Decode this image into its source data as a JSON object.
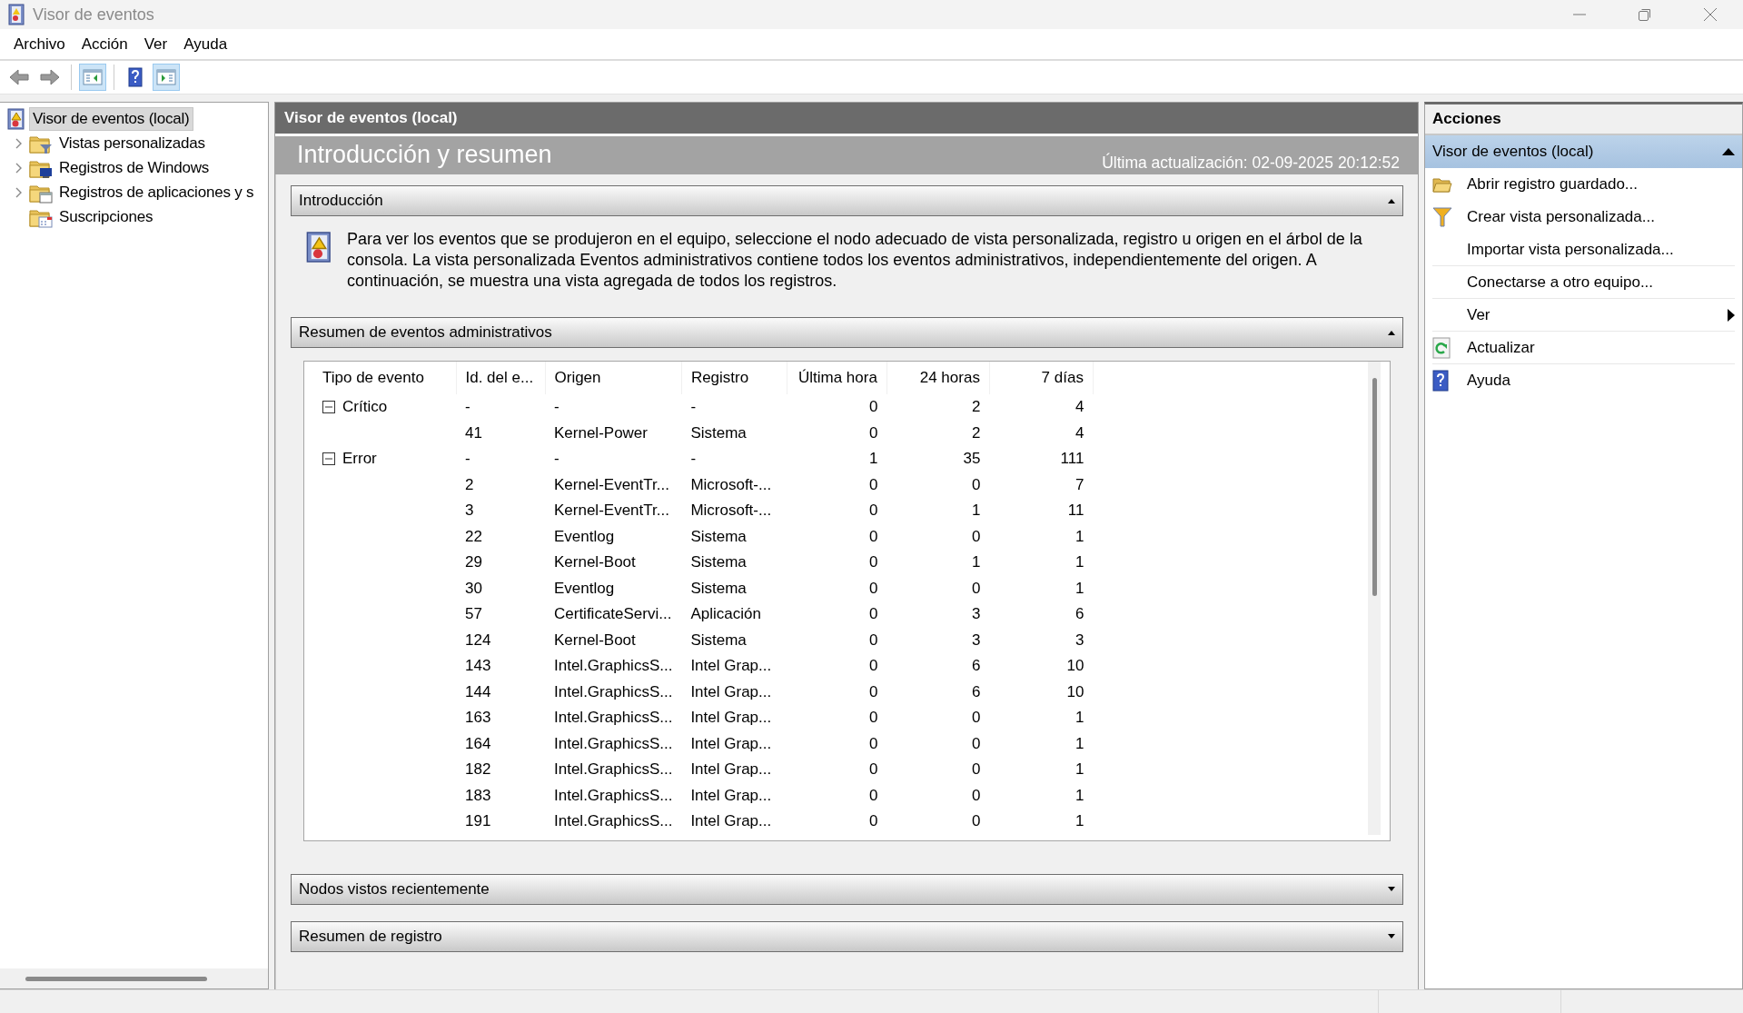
{
  "window": {
    "title": "Visor de eventos"
  },
  "menu": [
    {
      "label": "Archivo"
    },
    {
      "label": "Acción"
    },
    {
      "label": "Ver"
    },
    {
      "label": "Ayuda"
    }
  ],
  "toolbar_groups": [
    {
      "buttons": [
        {
          "kind": "back",
          "on": false,
          "disabled": true
        },
        {
          "kind": "forward",
          "on": false,
          "disabled": true
        }
      ]
    },
    {
      "buttons": [
        {
          "kind": "tree-pane",
          "on": true,
          "disabled": false
        }
      ]
    },
    {
      "buttons": [
        {
          "kind": "help",
          "on": false,
          "disabled": false
        },
        {
          "kind": "action-pane",
          "on": true,
          "disabled": false
        }
      ]
    }
  ],
  "tree": [
    {
      "label": "Visor de eventos (local)",
      "kind": "log",
      "selected": true,
      "children": [
        {
          "label": "Vistas personalizadas",
          "kind": "filter-folder",
          "selected": false,
          "expandable": true
        },
        {
          "label": "Registros de Windows",
          "kind": "windows-folder",
          "selected": false,
          "expandable": true
        },
        {
          "label": "Registros de aplicaciones y s",
          "kind": "window-folder",
          "selected": false,
          "expandable": true
        },
        {
          "label": "Suscripciones",
          "kind": "calendar-folder",
          "selected": false,
          "expandable": false
        }
      ]
    }
  ],
  "center": {
    "title": "Visor de eventos (local)",
    "heading": "Introducción y resumen",
    "updated": "Última actualización: 02-09-2025 20:12:52",
    "sections": [
      {
        "title": "Introducción",
        "expanded": true,
        "kind": "text",
        "text": "Para ver los eventos que se produjeron en el equipo, seleccione el nodo adecuado de vista personalizada, registro u origen en el árbol de la consola. La vista personalizada Eventos administrativos contiene todos los eventos administrativos, independientemente del origen. A continuación, se muestra una vista agregada de todos los registros."
      },
      {
        "title": "Resumen de eventos administrativos",
        "expanded": true,
        "kind": "table",
        "columns": [
          "Tipo de evento",
          "Id. del e...",
          "Origen",
          "Registro",
          "Última hora",
          "24 horas",
          "7 días"
        ],
        "rows": [
          {
            "kind": "group",
            "expanded": true,
            "cells": [
              "Crítico",
              "-",
              "-",
              "-",
              "0",
              "2",
              "4"
            ]
          },
          {
            "kind": "item",
            "cells": [
              "41",
              "Kernel-Power",
              "Sistema",
              "0",
              "2",
              "4"
            ]
          },
          {
            "kind": "group",
            "expanded": true,
            "cells": [
              "Error",
              "-",
              "-",
              "-",
              "1",
              "35",
              "111"
            ]
          },
          {
            "kind": "item",
            "cells": [
              "2",
              "Kernel-EventTr...",
              "Microsoft-...",
              "0",
              "0",
              "7"
            ]
          },
          {
            "kind": "item",
            "cells": [
              "3",
              "Kernel-EventTr...",
              "Microsoft-...",
              "0",
              "1",
              "11"
            ]
          },
          {
            "kind": "item",
            "cells": [
              "22",
              "Eventlog",
              "Sistema",
              "0",
              "0",
              "1"
            ]
          },
          {
            "kind": "item",
            "cells": [
              "29",
              "Kernel-Boot",
              "Sistema",
              "0",
              "1",
              "1"
            ]
          },
          {
            "kind": "item",
            "cells": [
              "30",
              "Eventlog",
              "Sistema",
              "0",
              "0",
              "1"
            ]
          },
          {
            "kind": "item",
            "cells": [
              "57",
              "CertificateServi...",
              "Aplicación",
              "0",
              "3",
              "6"
            ]
          },
          {
            "kind": "item",
            "cells": [
              "124",
              "Kernel-Boot",
              "Sistema",
              "0",
              "3",
              "3"
            ]
          },
          {
            "kind": "item",
            "cells": [
              "143",
              "Intel.GraphicsS...",
              "Intel Grap...",
              "0",
              "6",
              "10"
            ]
          },
          {
            "kind": "item",
            "cells": [
              "144",
              "Intel.GraphicsS...",
              "Intel Grap...",
              "0",
              "6",
              "10"
            ]
          },
          {
            "kind": "item",
            "cells": [
              "163",
              "Intel.GraphicsS...",
              "Intel Grap...",
              "0",
              "0",
              "1"
            ]
          },
          {
            "kind": "item",
            "cells": [
              "164",
              "Intel.GraphicsS...",
              "Intel Grap...",
              "0",
              "0",
              "1"
            ]
          },
          {
            "kind": "item",
            "cells": [
              "182",
              "Intel.GraphicsS...",
              "Intel Grap...",
              "0",
              "0",
              "1"
            ]
          },
          {
            "kind": "item",
            "cells": [
              "183",
              "Intel.GraphicsS...",
              "Intel Grap...",
              "0",
              "0",
              "1"
            ]
          },
          {
            "kind": "item",
            "cells": [
              "191",
              "Intel.GraphicsS...",
              "Intel Grap...",
              "0",
              "0",
              "1"
            ]
          }
        ]
      },
      {
        "title": "Nodos vistos recientemente",
        "expanded": false
      },
      {
        "title": "Resumen de registro",
        "expanded": false
      }
    ]
  },
  "actions": {
    "title": "Acciones",
    "group": {
      "label": "Visor de eventos (local)",
      "expanded": true
    },
    "items": [
      {
        "label": "Abrir registro guardado...",
        "kind": "folder",
        "separator": false,
        "submenu": false
      },
      {
        "label": "Crear vista personalizada...",
        "kind": "filter",
        "separator": false,
        "submenu": false
      },
      {
        "label": "Importar vista personalizada...",
        "kind": "plain",
        "separator": true,
        "submenu": false
      },
      {
        "label": "Conectarse a otro equipo...",
        "kind": "plain",
        "separator": true,
        "submenu": false
      },
      {
        "label": "Ver",
        "kind": "plain",
        "separator": true,
        "submenu": true
      },
      {
        "label": "Actualizar",
        "kind": "refresh",
        "separator": true,
        "submenu": false
      },
      {
        "label": "Ayuda",
        "kind": "help",
        "separator": false,
        "submenu": false
      }
    ]
  }
}
